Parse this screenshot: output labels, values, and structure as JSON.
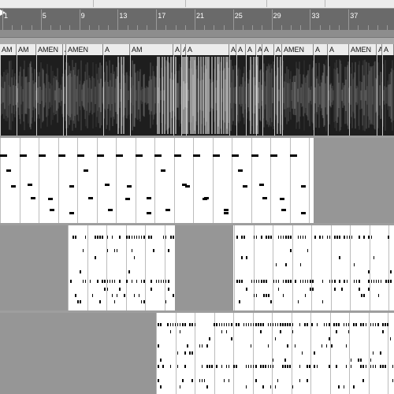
{
  "ruler": {
    "bar_numbers": [
      "1",
      "5",
      "9",
      "13",
      "17",
      "21",
      "25",
      "29",
      "33",
      "37"
    ]
  },
  "clips": [
    {
      "label": "AM"
    },
    {
      "label": "AM"
    },
    {
      "label": "AMEN"
    },
    {
      "label": "A"
    },
    {
      "label": "AMEN"
    },
    {
      "label": "A"
    },
    {
      "label": "AM"
    },
    {
      "label": "A"
    },
    {
      "label": "AMEN"
    },
    {
      "label": "A"
    },
    {
      "label": "A"
    },
    {
      "label": "A"
    },
    {
      "label": "A"
    },
    {
      "label": "A"
    },
    {
      "label": "A"
    },
    {
      "label": "A"
    },
    {
      "label": "AMEN"
    },
    {
      "label": "A"
    },
    {
      "label": "A"
    },
    {
      "label": "AMEN"
    },
    {
      "label": "A"
    },
    {
      "label": "A"
    }
  ],
  "colors": {
    "waveform": "#cfcfcf",
    "clip_header": "#ececec",
    "midi_background": "#ffffff",
    "empty_region": "#969696",
    "note": "#000000"
  }
}
